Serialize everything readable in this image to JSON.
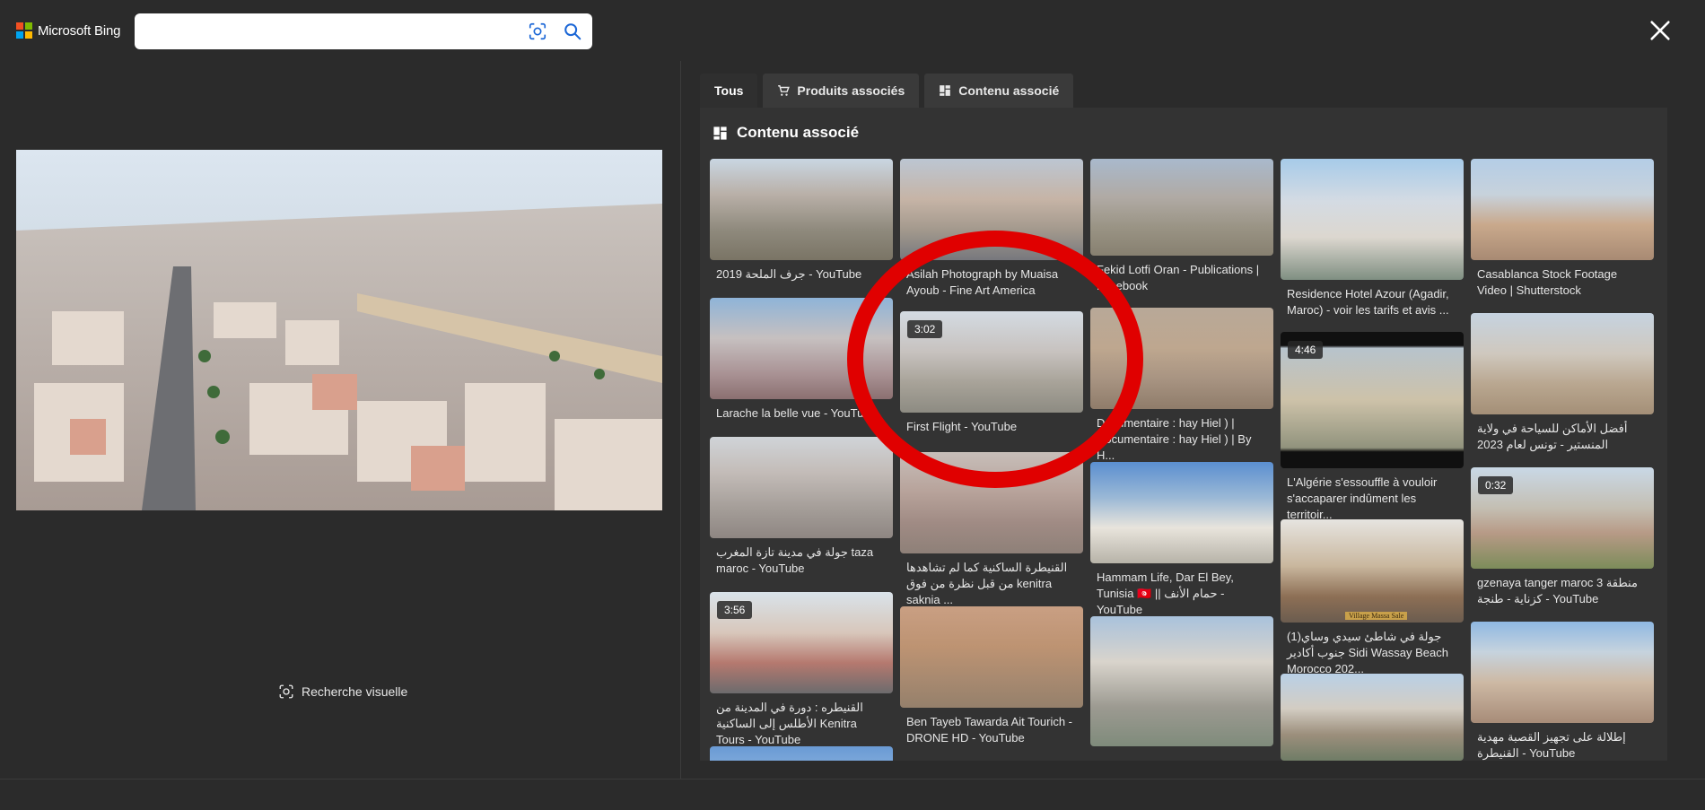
{
  "header": {
    "logo_text": "Microsoft Bing",
    "logo_colors": [
      "#f25022",
      "#7fba00",
      "#00a4ef",
      "#ffb900"
    ],
    "search_value": "",
    "search_placeholder": "",
    "camera_icon": "visual-search-icon",
    "search_icon": "search-icon",
    "close_icon": "close-icon"
  },
  "left": {
    "visual_search_label": "Recherche visuelle"
  },
  "tabs": [
    {
      "label": "Tous",
      "icon": ""
    },
    {
      "label": "Produits associés",
      "icon": "cart-icon"
    },
    {
      "label": "Contenu associé",
      "icon": "grid-icon"
    }
  ],
  "panel": {
    "title": "Contenu associé"
  },
  "cards": [
    {
      "caption": "جرف الملحة 2019 - YouTube",
      "duration": ""
    },
    {
      "caption": "Larache la belle vue - YouTube",
      "duration": ""
    },
    {
      "caption": "جولة في مدينة تازة المغرب taza maroc - YouTube",
      "duration": ""
    },
    {
      "caption": "القنيطره : دورة في المدينة من الأطلس إلى الساكنية Kenitra Tours - YouTube",
      "duration": "3:56"
    },
    {
      "caption": "",
      "duration": ""
    },
    {
      "caption": "Asilah Photograph by Muaisa Ayoub - Fine Art America",
      "duration": ""
    },
    {
      "caption": "First Flight - YouTube",
      "duration": "3:02"
    },
    {
      "caption": "القنيطرة الساكنية كما لم تشاهدها من قبل نظرة من فوق kenitra saknia ...",
      "duration": ""
    },
    {
      "caption": "Ben Tayeb Tawarda Ait Tourich - DRONE HD - YouTube",
      "duration": ""
    },
    {
      "caption": "Fekid Lotfi Oran - Publications | Facebook",
      "duration": ""
    },
    {
      "caption": "Documentaire : hay Hiel ) | Documentaire : hay Hiel ) | By H...",
      "duration": ""
    },
    {
      "caption": "Hammam Life, Dar El Bey, Tunisia 🇹🇳 || حمام الأنف - YouTube",
      "duration": ""
    },
    {
      "caption": "Residence Hotel Azour (Agadir, Maroc) - voir les tarifs et avis ...",
      "duration": ""
    },
    {
      "caption": "L'Algérie s'essouffle à vouloir s'accaparer indûment les territoir...",
      "duration": "4:46"
    },
    {
      "caption": "جولة في شاطئ سيدي وساي(1) جنوب أكادير Sidi Wassay Beach Morocco 202...",
      "duration": ""
    },
    {
      "caption": "Casablanca Stock Footage Video | Shutterstock",
      "duration": ""
    },
    {
      "caption": "أفضل الأماكن للسياحة في ولاية المنستير - تونس لعام 2023",
      "duration": ""
    },
    {
      "caption": "gzenaya tanger maroc 3 منطقة كزناية - طنجة - YouTube",
      "duration": "0:32"
    },
    {
      "caption": "إطلالة على تجهيز القصبة مهدية القنيطرة - YouTube",
      "duration": ""
    },
    {
      "caption": "",
      "duration": ""
    }
  ],
  "sign_text": "Village Massa Sale"
}
